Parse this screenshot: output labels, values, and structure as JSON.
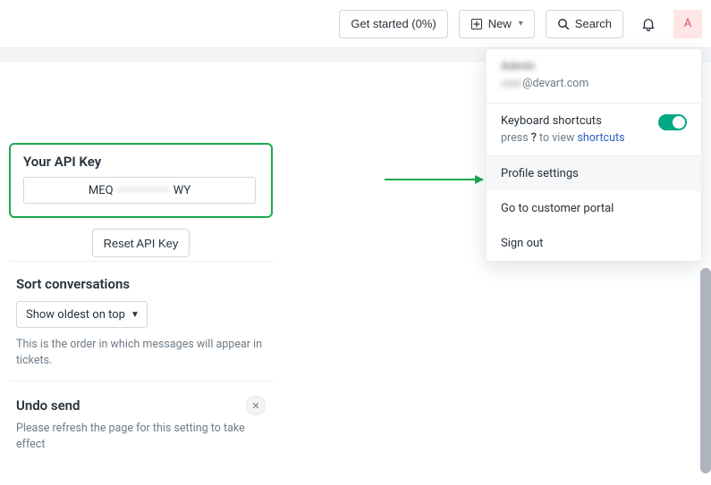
{
  "topbar": {
    "get_started": "Get started (0%)",
    "new": "New",
    "search": "Search",
    "avatar_letter": "A"
  },
  "api": {
    "title": "Your API Key",
    "key_prefix": "MEQ",
    "key_hidden": "•••••••••••",
    "key_suffix": "WY",
    "reset": "Reset API Key"
  },
  "sort": {
    "title": "Sort conversations",
    "selected": "Show oldest on top",
    "help": "This is the order in which messages will appear in tickets."
  },
  "undo": {
    "title": "Undo send",
    "help": "Please refresh the page for this setting to take effect"
  },
  "menu": {
    "name": "Admin",
    "email_hidden": "user",
    "email_domain": "@devart.com",
    "ks_label": "Keyboard shortcuts",
    "ks_help_prefix": "press ",
    "ks_help_key": "?",
    "ks_help_middle": " to view ",
    "ks_help_link": "shortcuts",
    "items": {
      "profile": "Profile settings",
      "portal": "Go to customer portal",
      "signout": "Sign out"
    }
  }
}
